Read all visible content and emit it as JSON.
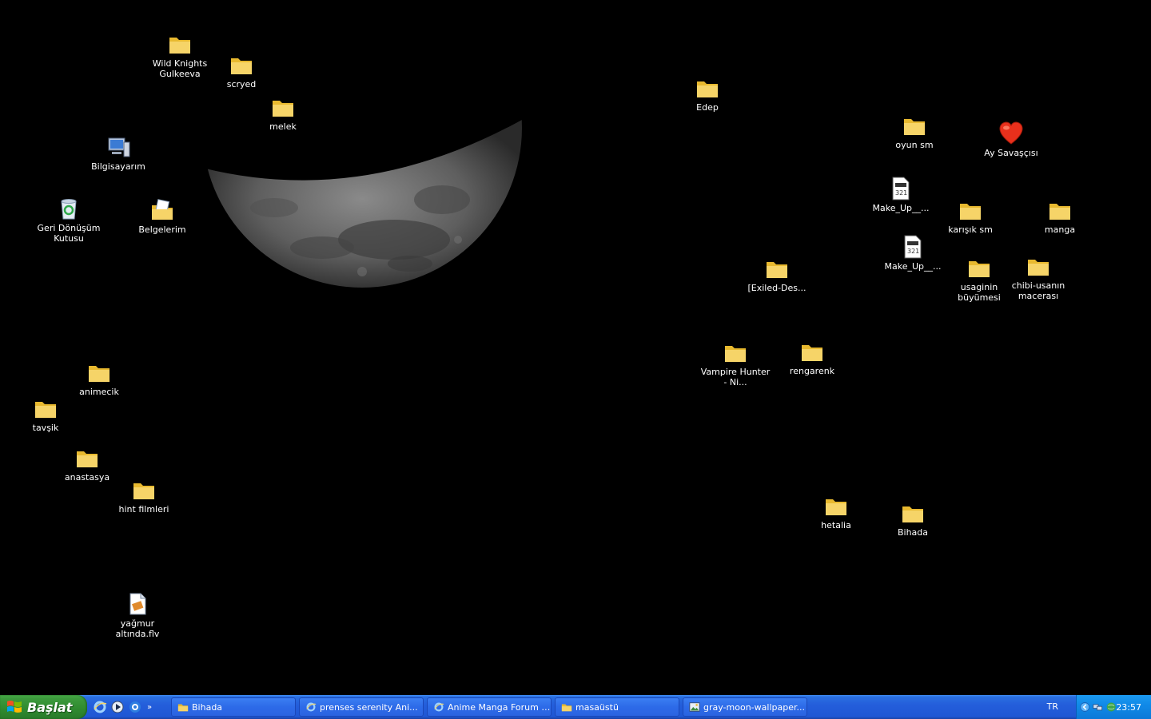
{
  "desktop": {
    "icons": [
      {
        "name": "folder-wild-knights",
        "label": "Wild Knights Gulkeeva",
        "type": "folder"
      },
      {
        "name": "folder-scryed",
        "label": "scryed",
        "type": "folder"
      },
      {
        "name": "folder-melek",
        "label": "melek",
        "type": "folder"
      },
      {
        "name": "my-computer",
        "label": "Bilgisayarım",
        "type": "computer"
      },
      {
        "name": "recycle-bin",
        "label": "Geri Dönüşüm Kutusu",
        "type": "recycle"
      },
      {
        "name": "my-documents",
        "label": "Belgelerim",
        "type": "documents"
      },
      {
        "name": "folder-animecik",
        "label": "animecik",
        "type": "folder"
      },
      {
        "name": "folder-tavsik",
        "label": "tavşik",
        "type": "folder"
      },
      {
        "name": "folder-anastasya",
        "label": "anastasya",
        "type": "folder"
      },
      {
        "name": "folder-hint-filmleri",
        "label": "hint filmleri",
        "type": "folder"
      },
      {
        "name": "file-yagmur-altinda",
        "label": "yağmur altında.flv",
        "type": "video"
      },
      {
        "name": "folder-edep",
        "label": "Edep",
        "type": "folder"
      },
      {
        "name": "folder-oyun-sm",
        "label": "oyun sm",
        "type": "folder"
      },
      {
        "name": "ay-savascisi",
        "label": "Ay Savaşçısı",
        "type": "heart"
      },
      {
        "name": "file-make-up-1",
        "label": "Make_Up__...",
        "type": "media"
      },
      {
        "name": "folder-karisik-sm",
        "label": "karışık sm",
        "type": "folder"
      },
      {
        "name": "folder-manga",
        "label": "manga",
        "type": "folder"
      },
      {
        "name": "file-make-up-2",
        "label": "Make_Up__...",
        "type": "media"
      },
      {
        "name": "folder-exiled-des",
        "label": "[Exiled-Des...",
        "type": "folder"
      },
      {
        "name": "folder-usaginin-buyumesi",
        "label": "usaginin büyümesi",
        "type": "folder"
      },
      {
        "name": "folder-chibi-usanin-macerasi",
        "label": "chibi-usanın macerası",
        "type": "folder"
      },
      {
        "name": "folder-vampire-hunter",
        "label": "Vampire Hunter - Ni...",
        "type": "folder"
      },
      {
        "name": "folder-rengarenk",
        "label": "rengarenk",
        "type": "folder"
      },
      {
        "name": "folder-hetalia",
        "label": "hetalia",
        "type": "folder"
      },
      {
        "name": "folder-bihada",
        "label": "Bihada",
        "type": "folder"
      }
    ]
  },
  "taskbar": {
    "start_label": "Başlat",
    "quick_launch_more": "»",
    "tasks": [
      {
        "label": "Bihada",
        "icon": "folder-icon"
      },
      {
        "label": "prenses serenity Ani...",
        "icon": "ie-icon"
      },
      {
        "label": "Anime Manga Forum -...",
        "icon": "ie-icon"
      },
      {
        "label": "masaüstü",
        "icon": "folder-icon"
      },
      {
        "label": "gray-moon-wallpaper...",
        "icon": "image-icon"
      }
    ],
    "language": "TR",
    "clock": "23:57"
  }
}
